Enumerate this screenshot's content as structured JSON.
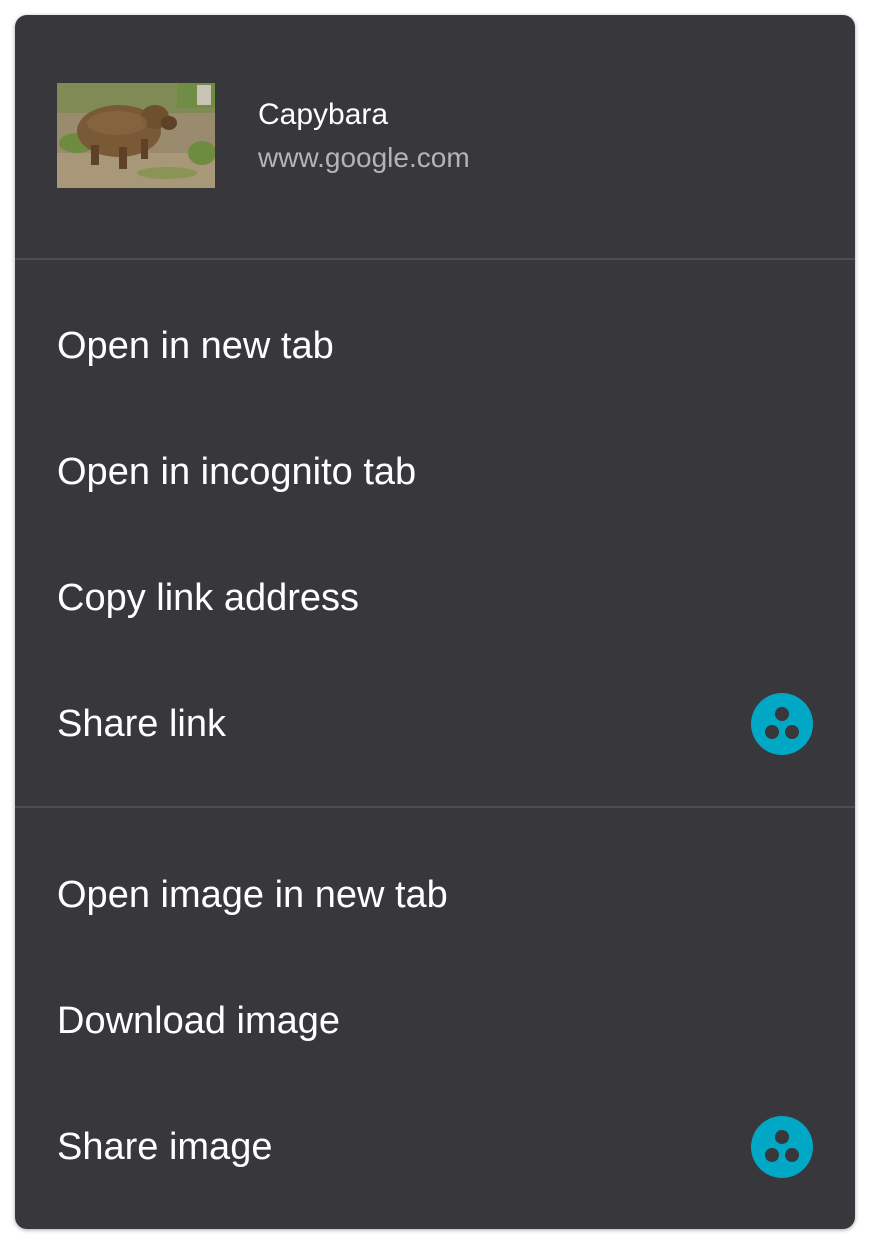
{
  "header": {
    "title": "Capybara",
    "url": "www.google.com",
    "thumbnail_alt": "capybara-thumbnail"
  },
  "link_items": [
    {
      "label": "Open in new tab"
    },
    {
      "label": "Open in incognito tab"
    },
    {
      "label": "Copy link address"
    },
    {
      "label": "Share link",
      "icon": "share-app-icon"
    }
  ],
  "image_items": [
    {
      "label": "Open image in new tab"
    },
    {
      "label": "Download image"
    },
    {
      "label": "Share image",
      "icon": "share-app-icon"
    }
  ],
  "colors": {
    "menu_background": "#38373c",
    "divider": "#4d4c52",
    "text_primary": "#ffffff",
    "text_secondary": "#b4b3b8",
    "share_icon": "#00a8c6"
  }
}
